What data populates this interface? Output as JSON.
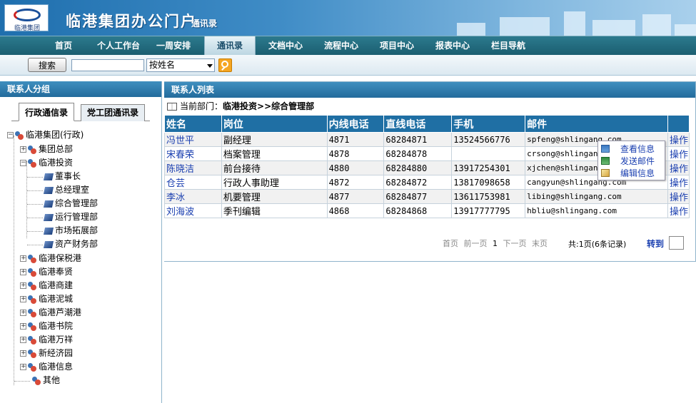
{
  "header": {
    "logo_text": "临港集团",
    "title": "临港集团办公门户",
    "subtitle": "通讯录"
  },
  "nav": {
    "items": [
      "首页",
      "个人工作台",
      "一周安排",
      "通讯录",
      "文档中心",
      "流程中心",
      "项目中心",
      "报表中心",
      "栏目导航"
    ],
    "active": "通讯录"
  },
  "search": {
    "button_label": "搜索",
    "input_value": "",
    "select_value": "按姓名"
  },
  "left": {
    "title": "联系人分组",
    "tabs": [
      "行政通信录",
      "党工团通讯录"
    ],
    "tree": {
      "root": "临港集团(行政)",
      "n1": "集团总部",
      "n2": "临港投资",
      "n2_children": [
        "董事长",
        "总经理室",
        "综合管理部",
        "运行管理部",
        "市场拓展部",
        "资产财务部"
      ],
      "others": [
        "临港保税港",
        "临港奉贤",
        "临港商建",
        "临港泥城",
        "临港芦潮港",
        "临港书院",
        "临港万祥",
        "新经济园",
        "临港信息",
        "其他"
      ]
    }
  },
  "right": {
    "title": "联系人列表",
    "dept_label": "当前部门：",
    "dept_path": "临港投资>>综合管理部",
    "columns": [
      "姓名",
      "岗位",
      "内线电话",
      "直线电话",
      "手机",
      "邮件",
      ""
    ],
    "rows": [
      {
        "name": "冯世平",
        "position": "副经理",
        "ext": "4871",
        "direct": "68284871",
        "mobile": "13524566776",
        "email": "spfeng@shlingang.com",
        "op": "操作"
      },
      {
        "name": "宋春荣",
        "position": "档案管理",
        "ext": "4878",
        "direct": "68284878",
        "mobile": "",
        "email": "crsong@shlingang.com",
        "op": "操作"
      },
      {
        "name": "陈晓洁",
        "position": "前台接待",
        "ext": "4880",
        "direct": "68284880",
        "mobile": "13917254301",
        "email": "xjchen@shlingang.com",
        "op": "操作"
      },
      {
        "name": "仓芸",
        "position": "行政人事助理",
        "ext": "4872",
        "direct": "68284872",
        "mobile": "13817098658",
        "email": "cangyun@shlingang.com",
        "op": "操作"
      },
      {
        "name": "李冰",
        "position": "机要管理",
        "ext": "4877",
        "direct": "68284877",
        "mobile": "13611753981",
        "email": "libing@shlingang.com",
        "op": "操作"
      },
      {
        "name": "刘海波",
        "position": "季刊编辑",
        "ext": "4868",
        "direct": "68284868",
        "mobile": "13917777795",
        "email": "hbliu@shlingang.com",
        "op": "操作"
      }
    ],
    "pager": {
      "first": "首页",
      "prev": "前一页",
      "page": "1",
      "next": "下一页",
      "last": "末页"
    },
    "total": "共:1页(6条记录)",
    "jump": "转到"
  },
  "context_menu": {
    "items": [
      "查看信息",
      "发送邮件",
      "编辑信息"
    ],
    "icons": [
      "view-info-icon",
      "send-mail-icon",
      "edit-info-icon"
    ]
  }
}
